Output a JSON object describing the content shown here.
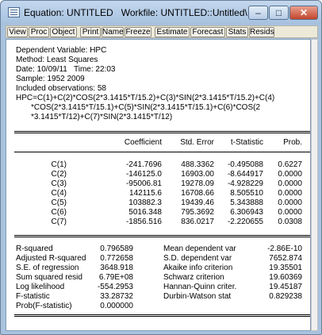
{
  "window": {
    "title": "Equation: UNTITLED   Workfile: UNTITLED::Untitled\\",
    "minimize_glyph": "–",
    "maximize_glyph": "□",
    "close_glyph": "✕"
  },
  "toolbar": [
    "View",
    "Proc",
    "Object",
    "Print",
    "Name",
    "Freeze",
    "Estimate",
    "Forecast",
    "Stats",
    "Resids"
  ],
  "header": {
    "dependent": "Dependent Variable: HPC",
    "method": "Method: Least Squares",
    "date": "Date: 10/09/11   Time: 22:03",
    "sample": "Sample: 1952 2009",
    "observations": "Included observations: 58",
    "equation_lines": [
      "HPC=C(1)+C(2)*COS(2*3.1415*T/15.2)+C(3)*SIN(2*3.1415*T/15.2)+C(4)",
      "*COS(2*3.1415*T/15.1)+C(5)*SIN(2*3.1415*T/15.1)+C(6)*COS(2",
      "*3.1415*T/12)+C(7)*SIN(2*3.1415*T/12)"
    ]
  },
  "coef_table": {
    "headers": [
      "Coefficient",
      "Std. Error",
      "t-Statistic",
      "Prob."
    ],
    "rows": [
      {
        "name": "C(1)",
        "coef": "-241.7696",
        "se": "488.3362",
        "t": "-0.495088",
        "p": "0.6227"
      },
      {
        "name": "C(2)",
        "coef": "-146125.0",
        "se": "16903.00",
        "t": "-8.644917",
        "p": "0.0000"
      },
      {
        "name": "C(3)",
        "coef": "-95006.81",
        "se": "19278.09",
        "t": "-4.928229",
        "p": "0.0000"
      },
      {
        "name": "C(4)",
        "coef": "142115.6",
        "se": "16708.66",
        "t": "8.505510",
        "p": "0.0000"
      },
      {
        "name": "C(5)",
        "coef": "103882.3",
        "se": "19439.46",
        "t": "5.343888",
        "p": "0.0000"
      },
      {
        "name": "C(6)",
        "coef": "5016.348",
        "se": "795.3692",
        "t": "6.306943",
        "p": "0.0000"
      },
      {
        "name": "C(7)",
        "coef": "-1856.516",
        "se": "836.0217",
        "t": "-2.220655",
        "p": "0.0308"
      }
    ]
  },
  "stats": {
    "left": [
      {
        "label": "R-squared",
        "value": "0.796589"
      },
      {
        "label": "Adjusted R-squared",
        "value": "0.772658"
      },
      {
        "label": "S.E. of regression",
        "value": "3648.918"
      },
      {
        "label": "Sum squared resid",
        "value": "6.79E+08"
      },
      {
        "label": "Log likelihood",
        "value": "-554.2953"
      },
      {
        "label": "F-statistic",
        "value": "33.28732"
      },
      {
        "label": "Prob(F-statistic)",
        "value": "0.000000"
      }
    ],
    "right": [
      {
        "label": "Mean dependent var",
        "value": "-2.86E-10"
      },
      {
        "label": "S.D. dependent var",
        "value": "7652.874"
      },
      {
        "label": "Akaike info criterion",
        "value": "19.35501"
      },
      {
        "label": "Schwarz criterion",
        "value": "19.60369"
      },
      {
        "label": "Hannan-Quinn criter.",
        "value": "19.45187"
      },
      {
        "label": "Durbin-Watson stat",
        "value": "0.829238"
      }
    ]
  }
}
